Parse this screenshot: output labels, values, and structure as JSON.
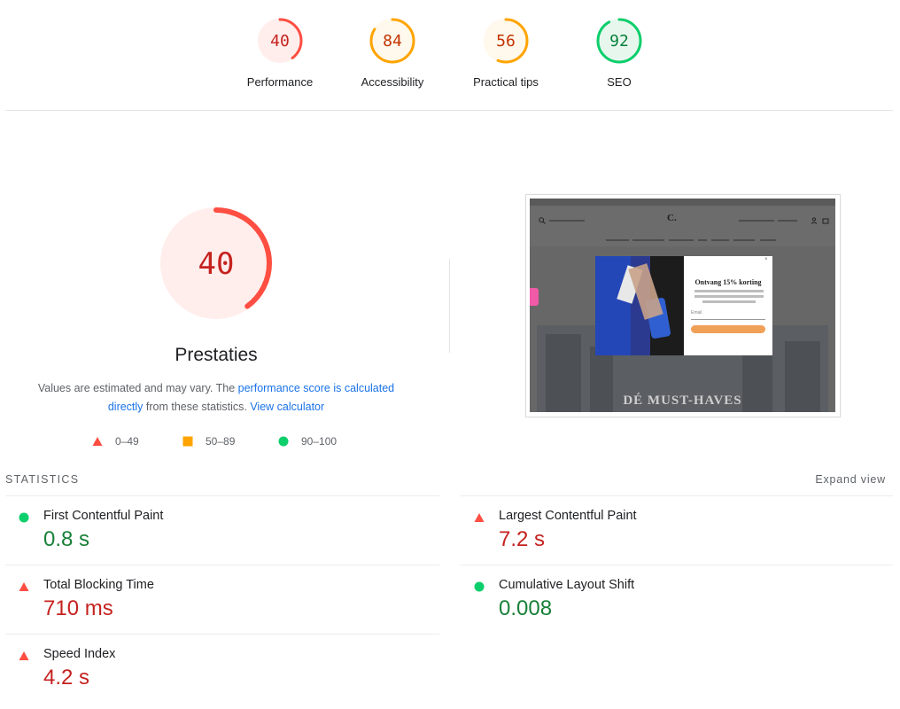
{
  "colors": {
    "fail": "#ff4e42",
    "fail_text": "#c5221f",
    "average": "#ffa400",
    "average_text": "#c33300",
    "pass": "#0cce6b",
    "pass_text": "#08803c",
    "link": "#1a73e8"
  },
  "categories": [
    {
      "label": "Performance",
      "score": "40",
      "status": "fail"
    },
    {
      "label": "Accessibility",
      "score": "84",
      "status": "average"
    },
    {
      "label": "Practical tips",
      "score": "56",
      "status": "average"
    },
    {
      "label": "SEO",
      "score": "92",
      "status": "pass"
    }
  ],
  "main_gauge": {
    "score": "40",
    "title": "Prestaties"
  },
  "description": {
    "prefix": "Values are estimated and may vary. The ",
    "link1": "performance score is calculated directly",
    "middle": " from these statistics. ",
    "link2": "View calculator"
  },
  "legend": [
    {
      "range": "0–49",
      "icon": "triangle-icon"
    },
    {
      "range": "50–89",
      "icon": "square-icon"
    },
    {
      "range": "90–100",
      "icon": "circle-icon"
    }
  ],
  "screenshot": {
    "logo": "C.",
    "popup_title": "Ontvang 15% korting",
    "popup_field": "Email",
    "hero_text": "DÉ MUST-HAVES"
  },
  "statistics": {
    "heading": "STATISTICS",
    "expand_label": "Expand view",
    "metrics": [
      {
        "name": "First Contentful Paint",
        "value": "0.8 s",
        "status": "pass"
      },
      {
        "name": "Largest Contentful Paint",
        "value": "7.2 s",
        "status": "fail"
      },
      {
        "name": "Total Blocking Time",
        "value": "710 ms",
        "status": "fail"
      },
      {
        "name": "Cumulative Layout Shift",
        "value": "0.008",
        "status": "pass"
      },
      {
        "name": "Speed Index",
        "value": "4.2 s",
        "status": "fail"
      }
    ]
  }
}
